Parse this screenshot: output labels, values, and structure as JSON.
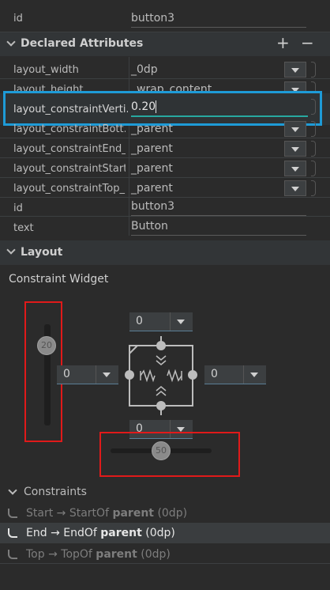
{
  "top": {
    "id_label": "id",
    "id_value": "button3"
  },
  "declared": {
    "title": "Declared Attributes",
    "add": "+",
    "remove": "−"
  },
  "attrs": [
    {
      "name": "layout_width",
      "value": "_0dp"
    },
    {
      "name": "layout_height",
      "value": "_wrap_content"
    },
    {
      "name": "layout_constraintVerti...",
      "value": "0.20"
    },
    {
      "name": "layout_constraintBott...",
      "value": "_parent"
    },
    {
      "name": "layout_constraintEnd_...",
      "value": "_parent"
    },
    {
      "name": "layout_constraintStart...",
      "value": "_parent"
    },
    {
      "name": "layout_constraintTop_...",
      "value": "_parent"
    },
    {
      "name": "id",
      "value": "button3"
    },
    {
      "name": "text",
      "value": "Button"
    }
  ],
  "layout": {
    "title": "Layout",
    "widget_title": "Constraint Widget"
  },
  "widget": {
    "vertical_bias": "20",
    "horizontal_bias": "50",
    "margin_top": "0",
    "margin_left": "0",
    "margin_right": "0",
    "margin_bottom": "0"
  },
  "constraints": {
    "title": "Constraints",
    "items": [
      {
        "side": "Start",
        "arrow": "→",
        "target": "StartOf",
        "parent": "parent",
        "margin": "(0dp)"
      },
      {
        "side": "End",
        "arrow": "→",
        "target": "EndOf",
        "parent": "parent",
        "margin": "(0dp)"
      },
      {
        "side": "Top",
        "arrow": "→",
        "target": "TopOf",
        "parent": "parent",
        "margin": "(0dp)"
      }
    ]
  },
  "colors": {
    "highlight": "#1e9bd7",
    "annotation": "#e01a1a",
    "accent": "#27a8a0"
  }
}
